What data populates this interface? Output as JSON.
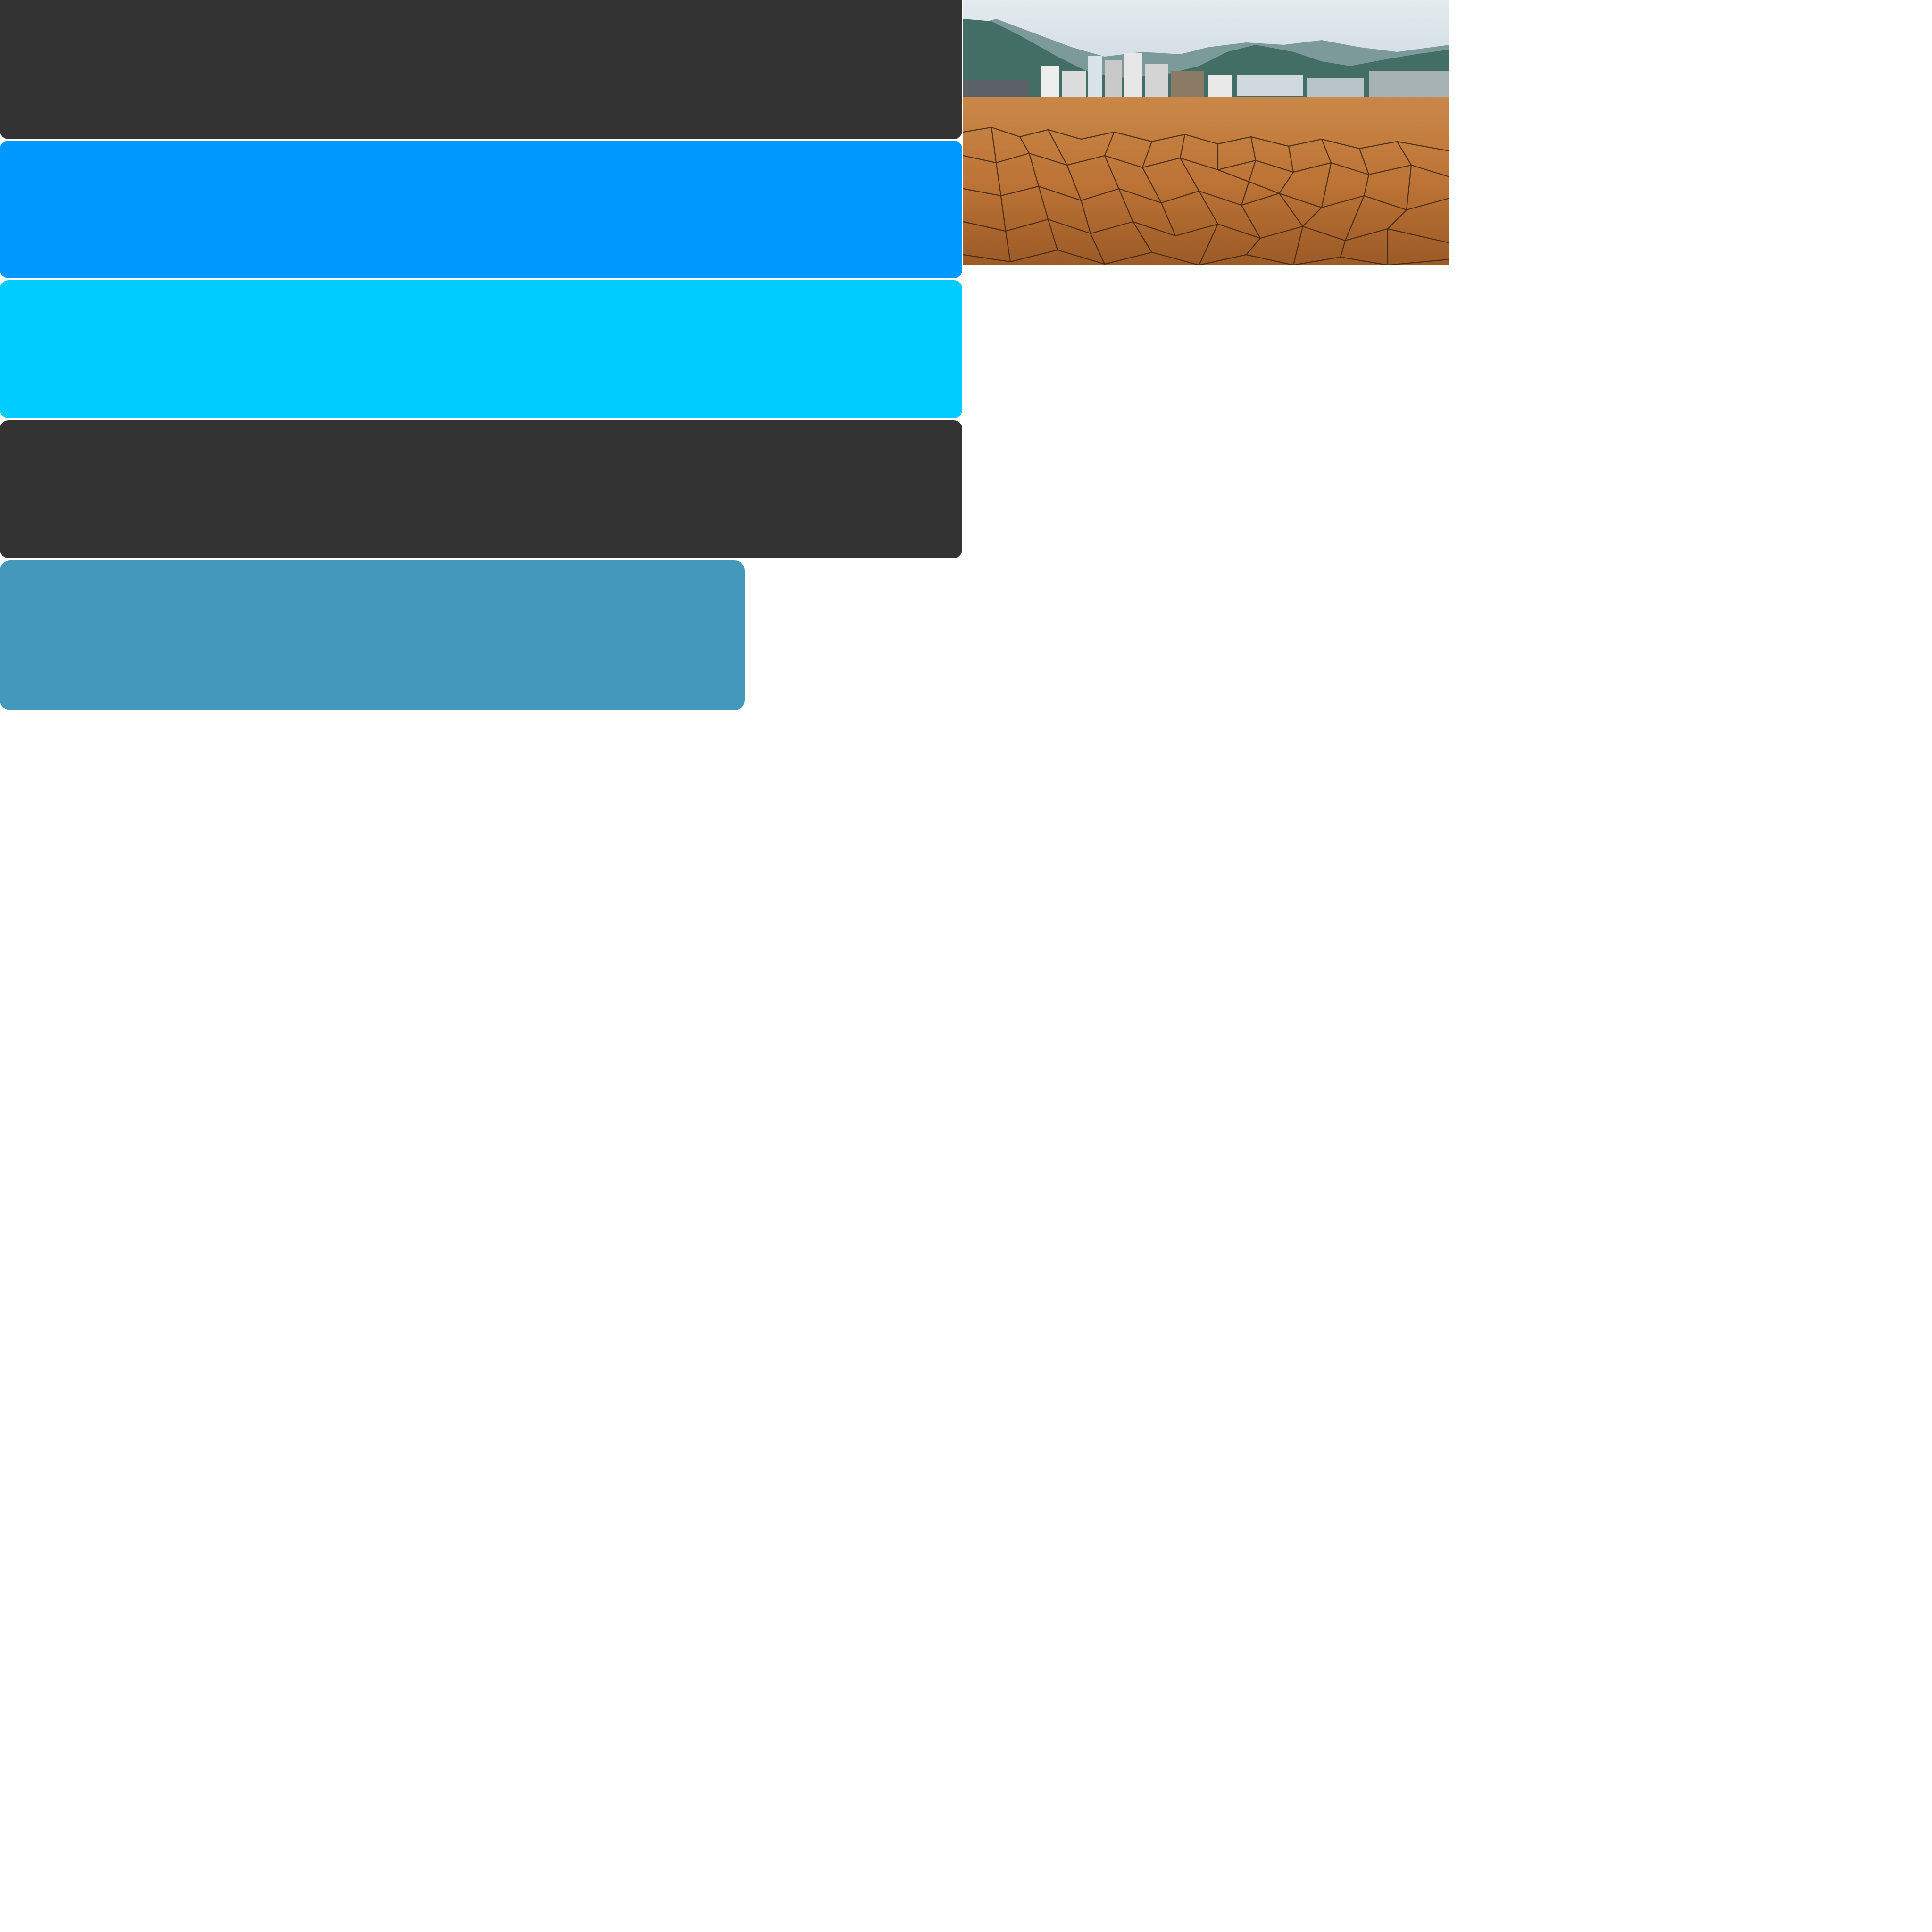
{
  "panels": [
    {
      "name": "dark-panel-top",
      "color": "#333333"
    },
    {
      "name": "blue-panel",
      "color": "#0099ff"
    },
    {
      "name": "cyan-panel",
      "color": "#00ccff"
    },
    {
      "name": "dark-panel-bottom",
      "color": "#333333"
    },
    {
      "name": "steel-blue-panel",
      "color": "#4398bb"
    }
  ],
  "photo": {
    "subject": "dry-cracked-riverbed-photo",
    "colors": {
      "sky": "#cdd8e0",
      "mountain_far": "#6f8d8f",
      "mountain_near": "#3f6a63",
      "ground": "#c07a3e",
      "ground_dark": "#8d4f22",
      "crack": "#3a2414"
    }
  }
}
